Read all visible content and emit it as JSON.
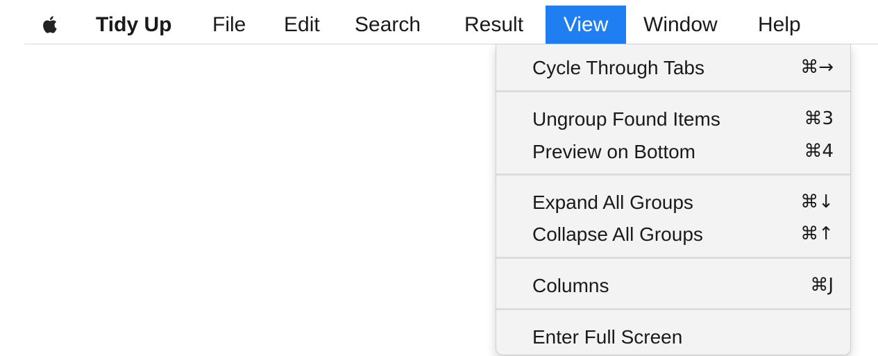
{
  "menubar": {
    "app_name": "Tidy Up",
    "items": [
      "File",
      "Edit",
      "Search",
      "Result",
      "View",
      "Window",
      "Help"
    ],
    "active": "View",
    "accent_color": "#1f7ef1"
  },
  "view_menu": {
    "items": [
      {
        "label": "Cycle Through Tabs",
        "shortcut": "⌘→"
      },
      {
        "label": "Ungroup Found Items",
        "shortcut": "⌘3"
      },
      {
        "label": "Preview on Bottom",
        "shortcut": "⌘4"
      },
      {
        "label": "Expand All Groups",
        "shortcut": "⌘↓"
      },
      {
        "label": "Collapse All Groups",
        "shortcut": "⌘↑"
      },
      {
        "label": "Columns",
        "shortcut": "⌘J"
      },
      {
        "label": "Enter Full Screen",
        "shortcut": ""
      }
    ]
  }
}
